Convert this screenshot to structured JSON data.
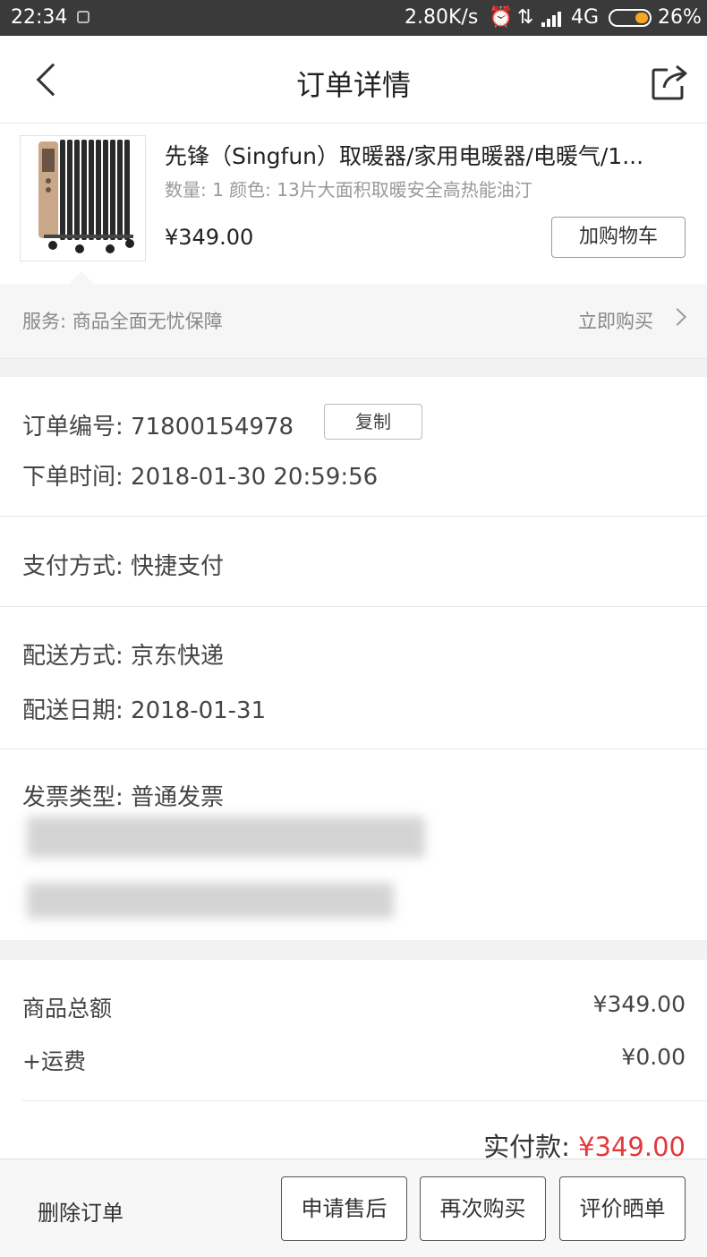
{
  "status_bar": {
    "time": "22:34",
    "net_speed": "2.80K/s",
    "network": "4G",
    "battery": "26%",
    "battery_color": "#f5a623"
  },
  "nav": {
    "title": "订单详情",
    "back_icon": "chevron-left-icon",
    "share_icon": "share-icon"
  },
  "product": {
    "name": "先锋（Singfun）取暖器/家用电暖器/电暖气/1...",
    "spec": "数量: 1 颜色: 13片大面积取暖安全高热能油汀",
    "price": "¥349.00",
    "add_to_cart": "加购物车"
  },
  "service": {
    "label": "服务: 商品全面无忧保障",
    "buy_now": "立即购买"
  },
  "order": {
    "number_label": "订单编号: 71800154978",
    "copy": "复制",
    "time_label": "下单时间: 2018-01-30 20:59:56",
    "payment": "支付方式: 快捷支付",
    "delivery_method": "配送方式: 京东快递",
    "delivery_date": "配送日期: 2018-01-31",
    "invoice_type": "发票类型: 普通发票"
  },
  "amounts": {
    "goods_label": "商品总额",
    "goods_value": "¥349.00",
    "shipping_label": "+运费",
    "shipping_value": "¥0.00",
    "paid_label": "实付款: ",
    "paid_value": "¥349.00",
    "accent_color": "#e4393c"
  },
  "bottom_bar": {
    "delete": "删除订单",
    "after_sale": "申请售后",
    "buy_again": "再次购买",
    "review": "评价晒单"
  }
}
